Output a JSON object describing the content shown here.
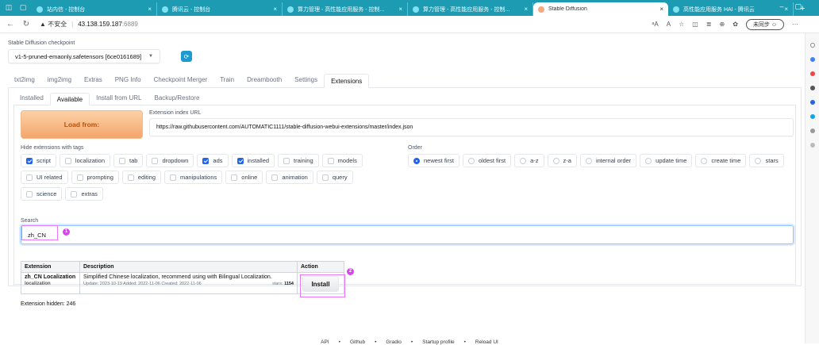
{
  "browser": {
    "tabs": [
      {
        "label": "站内信 - 控制台",
        "active": false
      },
      {
        "label": "腾讯云 - 控制台",
        "active": false
      },
      {
        "label": "算力管理 - 高性能应用服务 - 控制...",
        "active": false
      },
      {
        "label": "算力管理 - 高性能应用服务 - 控制...",
        "active": false
      },
      {
        "label": "Stable Diffusion",
        "active": true
      },
      {
        "label": "高性能应用服务 HAI - 腾讯云",
        "active": false
      }
    ],
    "security_warning": "▲ 不安全",
    "host": "43.138.159.187",
    "port": ":6889",
    "sync_label": "未同步"
  },
  "checkpoint": {
    "label": "Stable Diffusion checkpoint",
    "value": "v1-5-pruned-emaonly.safetensors [6ce0161689]"
  },
  "main_tabs": [
    "txt2img",
    "img2img",
    "Extras",
    "PNG Info",
    "Checkpoint Merger",
    "Train",
    "Dreambooth",
    "Settings",
    "Extensions"
  ],
  "main_active": "Extensions",
  "sub_tabs": [
    "Installed",
    "Available",
    "Install from URL",
    "Backup/Restore"
  ],
  "sub_active": "Available",
  "load_button": "Load from:",
  "index_url": {
    "label": "Extension index URL",
    "value": "https://raw.githubusercontent.com/AUTOMATIC1111/stable-diffusion-webui-extensions/master/index.json"
  },
  "hide_tags": {
    "label": "Hide extensions with tags",
    "items": [
      {
        "label": "script",
        "checked": true
      },
      {
        "label": "localization",
        "checked": false
      },
      {
        "label": "tab",
        "checked": false
      },
      {
        "label": "dropdown",
        "checked": false
      },
      {
        "label": "ads",
        "checked": true
      },
      {
        "label": "installed",
        "checked": true
      },
      {
        "label": "training",
        "checked": false
      },
      {
        "label": "models",
        "checked": false
      },
      {
        "label": "UI related",
        "checked": false
      },
      {
        "label": "prompting",
        "checked": false
      },
      {
        "label": "editing",
        "checked": false
      },
      {
        "label": "manipulations",
        "checked": false
      },
      {
        "label": "online",
        "checked": false
      },
      {
        "label": "animation",
        "checked": false
      },
      {
        "label": "query",
        "checked": false
      },
      {
        "label": "science",
        "checked": false
      },
      {
        "label": "extras",
        "checked": false
      }
    ]
  },
  "order": {
    "label": "Order",
    "items": [
      {
        "label": "newest first",
        "selected": true
      },
      {
        "label": "oldest first",
        "selected": false
      },
      {
        "label": "a-z",
        "selected": false
      },
      {
        "label": "z-a",
        "selected": false
      },
      {
        "label": "internal order",
        "selected": false
      },
      {
        "label": "update time",
        "selected": false
      },
      {
        "label": "create time",
        "selected": false
      },
      {
        "label": "stars",
        "selected": false
      }
    ]
  },
  "search": {
    "label": "Search",
    "value": "zh_CN"
  },
  "markers": [
    "1",
    "2"
  ],
  "table": {
    "headers": [
      "Extension",
      "Description",
      "Action"
    ],
    "rows": [
      {
        "name": "zh_CN Localization",
        "tag": "localization",
        "description": "Simplified Chinese localization, recommend using with Bilingual Localization.",
        "meta": "Update: 2023-10-19 Added: 2022-11-06 Created: 2022-11-06",
        "stars_label": "stars:",
        "stars": "1154",
        "action": "Install"
      }
    ]
  },
  "hidden_count": "Extension hidden: 246",
  "footer": [
    "API",
    "•",
    "Github",
    "•",
    "Gradio",
    "•",
    "Startup profile",
    "•",
    "Reload UI"
  ]
}
